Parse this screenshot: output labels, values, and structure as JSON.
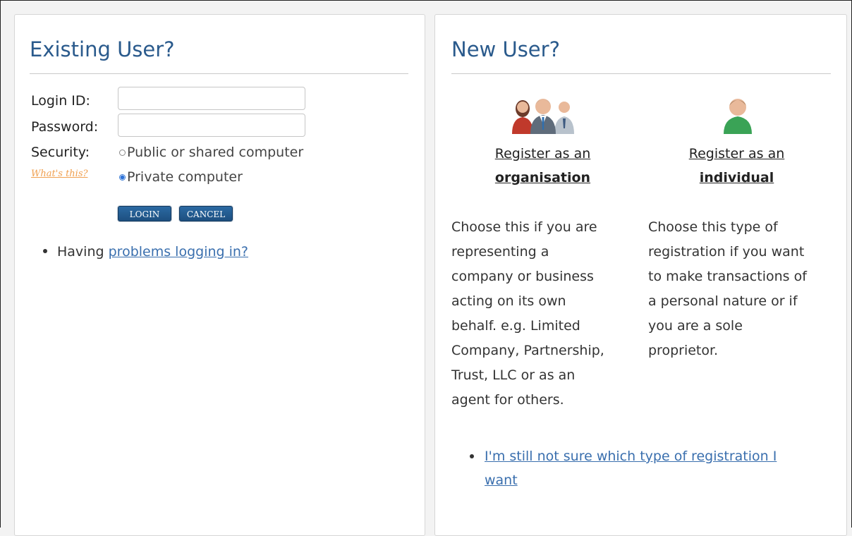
{
  "existing": {
    "title": "Existing User?",
    "login_label": "Login ID:",
    "password_label": "Password:",
    "security_label": "Security:",
    "whats_this": "What's this?",
    "security_options": [
      "Public or shared computer",
      "Private computer"
    ],
    "selected_security": "Private computer",
    "login_button": "LOGIN",
    "cancel_button": "CANCEL",
    "help_prefix": "Having ",
    "help_link": "problems logging in?"
  },
  "new_user": {
    "title": "New User?",
    "organisation": {
      "link_line1": "Register as an",
      "link_line2": "organisation",
      "description_lines": [
        "Choose this if you are",
        "representing a",
        "company or business",
        "acting on its own",
        "behalf. e.g. Limited",
        "Company, Partnership,",
        "Trust, LLC or as an",
        "agent for others."
      ]
    },
    "individual": {
      "link_line1": "Register as an",
      "link_line2": "individual",
      "description_lines": [
        "Choose this type of",
        "registration if you want",
        "to make transactions of",
        "a personal nature or if",
        "you are a sole",
        "proprietor."
      ]
    },
    "unsure_link_line1": "I'm still not sure which type of registration I",
    "unsure_link_line2": "want"
  },
  "colors": {
    "heading": "#2a5a8c",
    "link": "#3a6fae",
    "button": "#1d4f80",
    "whats_this": "#f0a050"
  }
}
